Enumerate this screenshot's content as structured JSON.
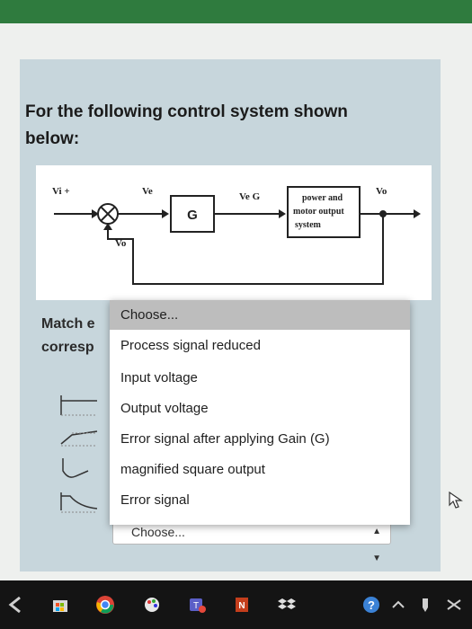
{
  "question": {
    "title_line1": "For the following control system shown",
    "title_line2": "below:"
  },
  "diagram": {
    "vi_label": "Vi +",
    "ve_label": "Ve",
    "gain_label": "G",
    "ve_g_label": "Ve G",
    "block_line1": "power and",
    "block_line2": "motor output",
    "block_line3": "system",
    "vo_out_label": "Vo",
    "vo_feedback_label": "Vo"
  },
  "match": {
    "line1": "Match e",
    "line2": "corresp"
  },
  "dropdown": {
    "options": [
      "Choose...",
      "Process signal reduced",
      "Input voltage",
      "Output voltage",
      "Error signal after applying Gain (G)",
      "magnified square output",
      "Error signal"
    ]
  },
  "select_bottom": {
    "value": "Choose..."
  },
  "colors": {
    "card": "#c7d6dc",
    "dropdown_selected": "#bdbdbd",
    "taskbar": "#141414"
  },
  "taskbar_icons": [
    "back-arrow-icon",
    "store-icon",
    "chrome-icon",
    "paint-icon",
    "teams-icon",
    "office-icon",
    "dropbox-icon",
    "help-icon",
    "chevron-up-icon",
    "pen-icon",
    "network-icon"
  ]
}
